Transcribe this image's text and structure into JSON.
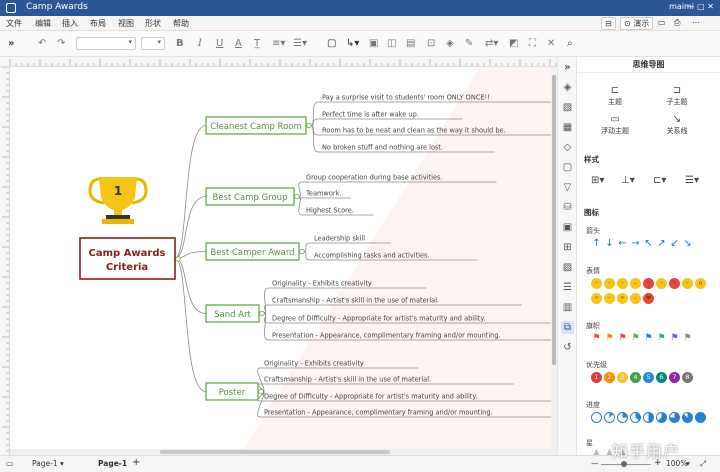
{
  "app": {
    "title": "Camp Awards",
    "user": "maimi",
    "window_controls": "—  □  ✕"
  },
  "menu": {
    "items": [
      "文件",
      "编辑",
      "插入",
      "布局",
      "视图",
      "形状",
      "帮助"
    ],
    "present": "演示"
  },
  "toolbar": {
    "font_placeholder": "",
    "size_placeholder": ""
  },
  "panel": {
    "title": "思维导图",
    "tools": [
      {
        "label": "主题"
      },
      {
        "label": "子主题"
      },
      {
        "label": "浮动主题"
      },
      {
        "label": "关系线"
      }
    ],
    "style_title": "样式",
    "icon_title": "图标",
    "arrows_title": "箭头",
    "emoji_title": "表情",
    "flags_title": "旗帜",
    "priority_title": "优先级",
    "priority_values": [
      "1",
      "2",
      "3",
      "4",
      "5",
      "6",
      "7",
      "8"
    ],
    "progress_title": "进度",
    "star_title": "星"
  },
  "mindmap": {
    "root": "Camp Awards Criteria",
    "branches": [
      {
        "label": "Cleanest Camp Room",
        "children": [
          "Pay a surprise visit to students' room ONLY ONCE!!",
          "Perfect time is after wake up.",
          "Room has to be neat and clean as the way it should be.",
          "No broken stuff and nothing are lost."
        ]
      },
      {
        "label": "Best Camp Group",
        "children": [
          "Group cooperation during base activities.",
          "Teamwork.",
          "Highest Score."
        ]
      },
      {
        "label": "Best Camper Award",
        "children": [
          "Leadership skill",
          "Accomplishing tasks and activities."
        ]
      },
      {
        "label": "Sand Art",
        "children": [
          "Originality - Exhibits creativity",
          "Craftsmanship - Artist's skill in the use of material.",
          "Degree of Difficulty - Appropriate for artist's maturity and ability.",
          "Presentation - Appearance, complimentary framing and/or mounting."
        ]
      },
      {
        "label": "Poster",
        "children": [
          "Originality - Exhibits creativity",
          "Craftsmanship - Artist's skill in the use of material.",
          "Degree of Difficulty - Appropriate for artist's maturity and ability.",
          "Presentation - Appearance, complimentary framing and/or mounting."
        ]
      }
    ]
  },
  "status": {
    "page_selector": "Page-1",
    "page_tab": "Page-1",
    "add_page": "+",
    "zoom": "100%"
  },
  "watermark": "知乎用户",
  "colors": {
    "titlebar": "#2b5797",
    "branch_border": "#6aa84f",
    "root_border": "#8b1c1c"
  }
}
